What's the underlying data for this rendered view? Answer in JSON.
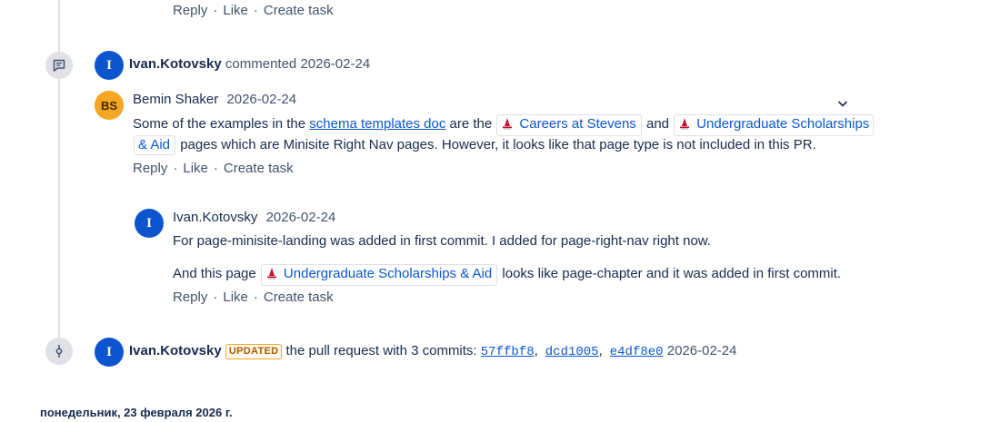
{
  "top_actions": {
    "reply": "Reply",
    "like": "Like",
    "create_task": "Create task"
  },
  "event1": {
    "avatar": "I",
    "author": "Ivan.Kotovsky",
    "action": "commented",
    "date": "2026-02-24",
    "icon": "comment-icon"
  },
  "comment1": {
    "avatar": "BS",
    "author": "Bemin Shaker",
    "date": "2026-02-24",
    "text_a": "Some of the examples in the",
    "link": "schema templates doc",
    "text_b": "are the",
    "chip1": "Careers at Stevens",
    "text_c": "and",
    "chip2_line1": "Undergraduate Scholarships",
    "chip2_line2": "& Aid",
    "text_d": "pages which are Minisite Right Nav pages. However, it looks like that page type is not included in this PR.",
    "actions": {
      "reply": "Reply",
      "like": "Like",
      "create_task": "Create task"
    },
    "collapse_icon": "chevron-down-icon"
  },
  "reply1": {
    "avatar": "I",
    "author": "Ivan.Kotovsky",
    "date": "2026-02-24",
    "para1": "For page-minisite-landing was added in first commit. I added for page-right-nav right now.",
    "para2_a": "And this page",
    "chip": "Undergraduate Scholarships & Aid",
    "para2_b": "looks like page-chapter and it was added in first commit.",
    "actions": {
      "reply": "Reply",
      "like": "Like",
      "create_task": "Create task"
    }
  },
  "event2": {
    "avatar": "I",
    "author": "Ivan.Kotovsky",
    "badge": "UPDATED",
    "text": "the pull request with 3 commits:",
    "commits": [
      "57ffbf8",
      "dcd1005",
      "e4df8e0"
    ],
    "date": "2026-02-24",
    "icon": "commit-icon"
  },
  "day_header": "понедельник, 23 февраля 2026 г."
}
